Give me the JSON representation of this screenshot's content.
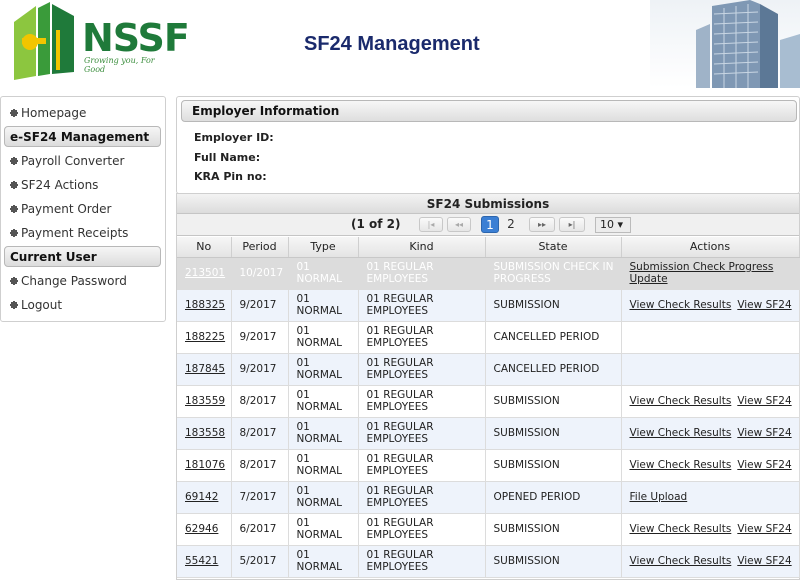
{
  "header": {
    "brand": "NSSF",
    "tagline": "Growing you, For Good",
    "title": "SF24 Management"
  },
  "sidebar": {
    "items": [
      {
        "type": "link",
        "label": "Homepage"
      },
      {
        "type": "header",
        "label": "e-SF24 Management"
      },
      {
        "type": "link",
        "label": "Payroll Converter"
      },
      {
        "type": "link",
        "label": "SF24 Actions"
      },
      {
        "type": "link",
        "label": "Payment Order"
      },
      {
        "type": "link",
        "label": "Payment Receipts"
      },
      {
        "type": "header",
        "label": "Current User"
      },
      {
        "type": "link",
        "label": "Change Password"
      },
      {
        "type": "link",
        "label": "Logout"
      }
    ]
  },
  "employer": {
    "title": "Employer Information",
    "id_label": "Employer ID:",
    "name_label": "Full Name:",
    "kra_label": "KRA Pin no:"
  },
  "submissions": {
    "title": "SF24 Submissions",
    "pager": {
      "status": "(1 of 2)",
      "first": "|◂",
      "prev": "◂◂",
      "pages": [
        "1",
        "2"
      ],
      "active_page": "1",
      "next": "▸▸",
      "last": "▸|",
      "rows_per_page": "10 ▾"
    },
    "columns": [
      "No",
      "Period",
      "Type",
      "Kind",
      "State",
      "Actions"
    ],
    "rows": [
      {
        "no": "213501",
        "period": "10/2017",
        "type": "01 NORMAL",
        "kind": "01 REGULAR EMPLOYEES",
        "state": "SUBMISSION CHECK IN PROGRESS",
        "actions": [
          "Submission Check Progress Update"
        ],
        "highlight": true
      },
      {
        "no": "188325",
        "period": "9/2017",
        "type": "01 NORMAL",
        "kind": "01 REGULAR EMPLOYEES",
        "state": "SUBMISSION",
        "actions": [
          "View Check Results",
          "View SF24"
        ]
      },
      {
        "no": "188225",
        "period": "9/2017",
        "type": "01 NORMAL",
        "kind": "01 REGULAR EMPLOYEES",
        "state": "CANCELLED PERIOD",
        "actions": []
      },
      {
        "no": "187845",
        "period": "9/2017",
        "type": "01 NORMAL",
        "kind": "01 REGULAR EMPLOYEES",
        "state": "CANCELLED PERIOD",
        "actions": []
      },
      {
        "no": "183559",
        "period": "8/2017",
        "type": "01 NORMAL",
        "kind": "01 REGULAR EMPLOYEES",
        "state": "SUBMISSION",
        "actions": [
          "View Check Results",
          "View SF24"
        ]
      },
      {
        "no": "183558",
        "period": "8/2017",
        "type": "01 NORMAL",
        "kind": "01 REGULAR EMPLOYEES",
        "state": "SUBMISSION",
        "actions": [
          "View Check Results",
          "View SF24"
        ]
      },
      {
        "no": "181076",
        "period": "8/2017",
        "type": "01 NORMAL",
        "kind": "01 REGULAR EMPLOYEES",
        "state": "SUBMISSION",
        "actions": [
          "View Check Results",
          "View SF24"
        ]
      },
      {
        "no": "69142",
        "period": "7/2017",
        "type": "01 NORMAL",
        "kind": "01 REGULAR EMPLOYEES",
        "state": "OPENED PERIOD",
        "actions": [
          "File Upload"
        ]
      },
      {
        "no": "62946",
        "period": "6/2017",
        "type": "01 NORMAL",
        "kind": "01 REGULAR EMPLOYEES",
        "state": "SUBMISSION",
        "actions": [
          "View Check Results",
          "View SF24"
        ]
      },
      {
        "no": "55421",
        "period": "5/2017",
        "type": "01 NORMAL",
        "kind": "01 REGULAR EMPLOYEES",
        "state": "SUBMISSION",
        "actions": [
          "View Check Results",
          "View SF24"
        ]
      }
    ]
  },
  "colors": {
    "brand_green": "#1f7a3a",
    "title_navy": "#1a2a6c",
    "active_page": "#3b7fd4",
    "row_alt": "#eef3fb",
    "row_highlight": "#dcdcdc"
  }
}
